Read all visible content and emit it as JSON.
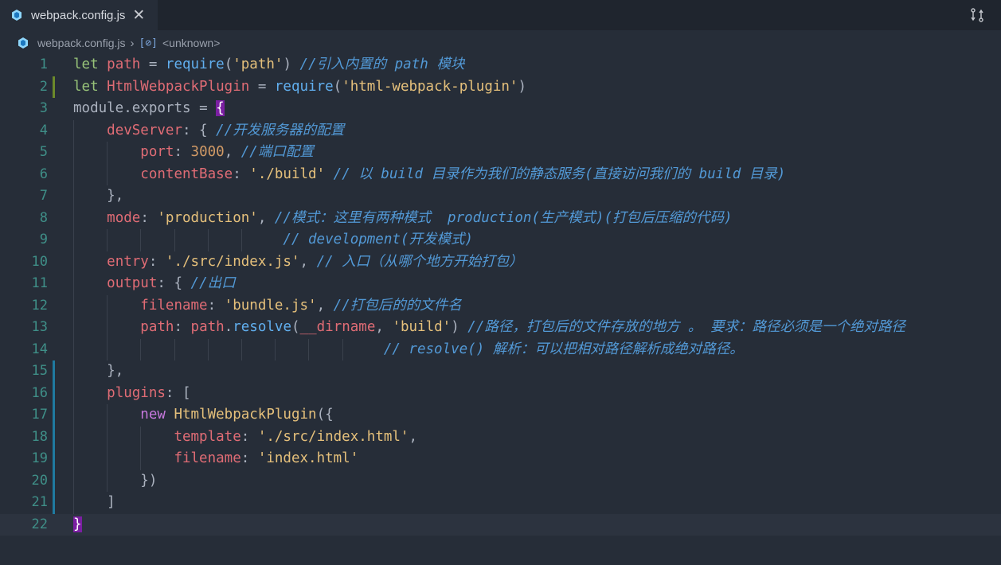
{
  "tab": {
    "label": "webpack.config.js",
    "close": "✕"
  },
  "breadcrumb": {
    "file": "webpack.config.js",
    "symbol_icon": "[⊘]",
    "symbol": "<unknown>"
  },
  "colors": {
    "background": "#262d38",
    "accent_bracket": "#7b1fa2",
    "line_numbers": "#3f8f88"
  },
  "lines": [
    {
      "n": "1",
      "t": [
        [
          "kw2",
          "let "
        ],
        [
          "var",
          "path"
        ],
        [
          "pun",
          " = "
        ],
        [
          "fn",
          "require"
        ],
        [
          "pun",
          "("
        ],
        [
          "str",
          "'path'"
        ],
        [
          "pun",
          ") "
        ],
        [
          "cm",
          "//引入内置的 path 模块"
        ]
      ]
    },
    {
      "n": "2",
      "t": [
        [
          "kw2",
          "let "
        ],
        [
          "var",
          "HtmlWebpackPlugin"
        ],
        [
          "pun",
          " = "
        ],
        [
          "fn",
          "require"
        ],
        [
          "pun",
          "("
        ],
        [
          "str",
          "'html-webpack-plugin'"
        ],
        [
          "pun",
          ")"
        ]
      ]
    },
    {
      "n": "3",
      "t": [
        [
          "pun",
          "module"
        ],
        [
          "pun",
          "."
        ],
        [
          "pun",
          "exports"
        ],
        [
          "pun",
          " = "
        ],
        [
          "hl",
          "{"
        ]
      ]
    },
    {
      "n": "4",
      "t": [
        [
          "pun",
          "    "
        ],
        [
          "prop",
          "devServer"
        ],
        [
          "pun",
          ": { "
        ],
        [
          "cm",
          "//开发服务器的配置"
        ]
      ]
    },
    {
      "n": "5",
      "t": [
        [
          "pun",
          "        "
        ],
        [
          "prop",
          "port"
        ],
        [
          "pun",
          ": "
        ],
        [
          "num",
          "3000"
        ],
        [
          "pun",
          ", "
        ],
        [
          "cm",
          "//端口配置"
        ]
      ]
    },
    {
      "n": "6",
      "t": [
        [
          "pun",
          "        "
        ],
        [
          "prop",
          "contentBase"
        ],
        [
          "pun",
          ": "
        ],
        [
          "str",
          "'./build'"
        ],
        [
          "pun",
          " "
        ],
        [
          "cm",
          "// 以 build 目录作为我们的静态服务(直接访问我们的 build 目录)"
        ]
      ]
    },
    {
      "n": "7",
      "t": [
        [
          "pun",
          "    },"
        ]
      ]
    },
    {
      "n": "8",
      "t": [
        [
          "pun",
          "    "
        ],
        [
          "prop",
          "mode"
        ],
        [
          "pun",
          ": "
        ],
        [
          "str",
          "'production'"
        ],
        [
          "pun",
          ", "
        ],
        [
          "cm",
          "//模式：这里有两种模式  production(生产模式)(打包后压缩的代码)"
        ]
      ]
    },
    {
      "n": "9",
      "t": [
        [
          "pun",
          "                         "
        ],
        [
          "cm",
          "// development(开发模式)"
        ]
      ]
    },
    {
      "n": "10",
      "t": [
        [
          "pun",
          "    "
        ],
        [
          "prop",
          "entry"
        ],
        [
          "pun",
          ": "
        ],
        [
          "str",
          "'./src/index.js'"
        ],
        [
          "pun",
          ", "
        ],
        [
          "cm",
          "// 入口（从哪个地方开始打包）"
        ]
      ]
    },
    {
      "n": "11",
      "t": [
        [
          "pun",
          "    "
        ],
        [
          "prop",
          "output"
        ],
        [
          "pun",
          ": { "
        ],
        [
          "cm",
          "//出口"
        ]
      ]
    },
    {
      "n": "12",
      "t": [
        [
          "pun",
          "        "
        ],
        [
          "prop",
          "filename"
        ],
        [
          "pun",
          ": "
        ],
        [
          "str",
          "'bundle.js'"
        ],
        [
          "pun",
          ", "
        ],
        [
          "cm",
          "//打包后的的文件名"
        ]
      ]
    },
    {
      "n": "13",
      "t": [
        [
          "pun",
          "        "
        ],
        [
          "prop",
          "path"
        ],
        [
          "pun",
          ": "
        ],
        [
          "var",
          "path"
        ],
        [
          "pun",
          "."
        ],
        [
          "fn",
          "resolve"
        ],
        [
          "pun",
          "("
        ],
        [
          "var",
          "__dirname"
        ],
        [
          "pun",
          ", "
        ],
        [
          "str",
          "'build'"
        ],
        [
          "pun",
          ") "
        ],
        [
          "cm",
          "//路径，打包后的文件存放的地方 。 要求：路径必须是一个绝对路径"
        ]
      ]
    },
    {
      "n": "14",
      "t": [
        [
          "pun",
          "                                     "
        ],
        [
          "cm",
          "// resolve() 解析：可以把相对路径解析成绝对路径。"
        ]
      ]
    },
    {
      "n": "15",
      "t": [
        [
          "pun",
          "    },"
        ]
      ]
    },
    {
      "n": "16",
      "t": [
        [
          "pun",
          "    "
        ],
        [
          "prop",
          "plugins"
        ],
        [
          "pun",
          ": ["
        ]
      ]
    },
    {
      "n": "17",
      "t": [
        [
          "pun",
          "        "
        ],
        [
          "kw",
          "new "
        ],
        [
          "cls",
          "HtmlWebpackPlugin"
        ],
        [
          "pun",
          "({"
        ]
      ]
    },
    {
      "n": "18",
      "t": [
        [
          "pun",
          "            "
        ],
        [
          "prop",
          "template"
        ],
        [
          "pun",
          ": "
        ],
        [
          "str",
          "'./src/index.html'"
        ],
        [
          "pun",
          ","
        ]
      ]
    },
    {
      "n": "19",
      "t": [
        [
          "pun",
          "            "
        ],
        [
          "prop",
          "filename"
        ],
        [
          "pun",
          ": "
        ],
        [
          "str",
          "'index.html'"
        ]
      ]
    },
    {
      "n": "20",
      "t": [
        [
          "pun",
          "        })"
        ]
      ]
    },
    {
      "n": "21",
      "t": [
        [
          "pun",
          "    ]"
        ]
      ]
    },
    {
      "n": "22",
      "t": [
        [
          "hl",
          "}"
        ]
      ]
    }
  ]
}
